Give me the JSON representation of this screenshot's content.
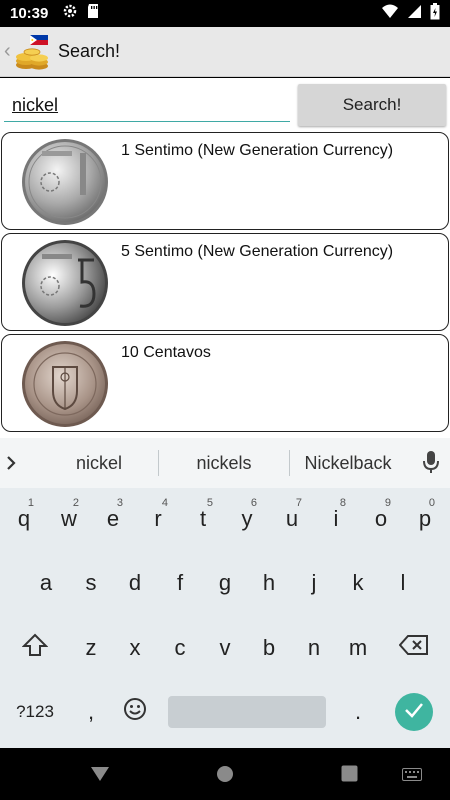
{
  "status": {
    "time": "10:39",
    "icons": [
      "gear-icon",
      "sd-card-icon",
      "wifi-icon",
      "signal-icon",
      "battery-icon"
    ]
  },
  "app_bar": {
    "title": "Search!",
    "back_glyph": "‹"
  },
  "search": {
    "value": "nickel",
    "button_label": "Search!"
  },
  "results": [
    {
      "label": "1 Sentimo (New Generation Currency)"
    },
    {
      "label": "5 Sentimo (New Generation Currency)"
    },
    {
      "label": "10 Centavos"
    }
  ],
  "keyboard": {
    "suggestions": [
      "nickel",
      "nickels",
      "Nickelback"
    ],
    "row1": [
      {
        "k": "q",
        "h": "1"
      },
      {
        "k": "w",
        "h": "2"
      },
      {
        "k": "e",
        "h": "3"
      },
      {
        "k": "r",
        "h": "4"
      },
      {
        "k": "t",
        "h": "5"
      },
      {
        "k": "y",
        "h": "6"
      },
      {
        "k": "u",
        "h": "7"
      },
      {
        "k": "i",
        "h": "8"
      },
      {
        "k": "o",
        "h": "9"
      },
      {
        "k": "p",
        "h": "0"
      }
    ],
    "row2": [
      "a",
      "s",
      "d",
      "f",
      "g",
      "h",
      "j",
      "k",
      "l"
    ],
    "row3": [
      "z",
      "x",
      "c",
      "v",
      "b",
      "n",
      "m"
    ],
    "symbols_label": "?123",
    "comma": ",",
    "period": "."
  },
  "colors": {
    "accent": "#3fb5a0",
    "status_bar": "#000000",
    "app_bar": "#e8e8e8"
  }
}
